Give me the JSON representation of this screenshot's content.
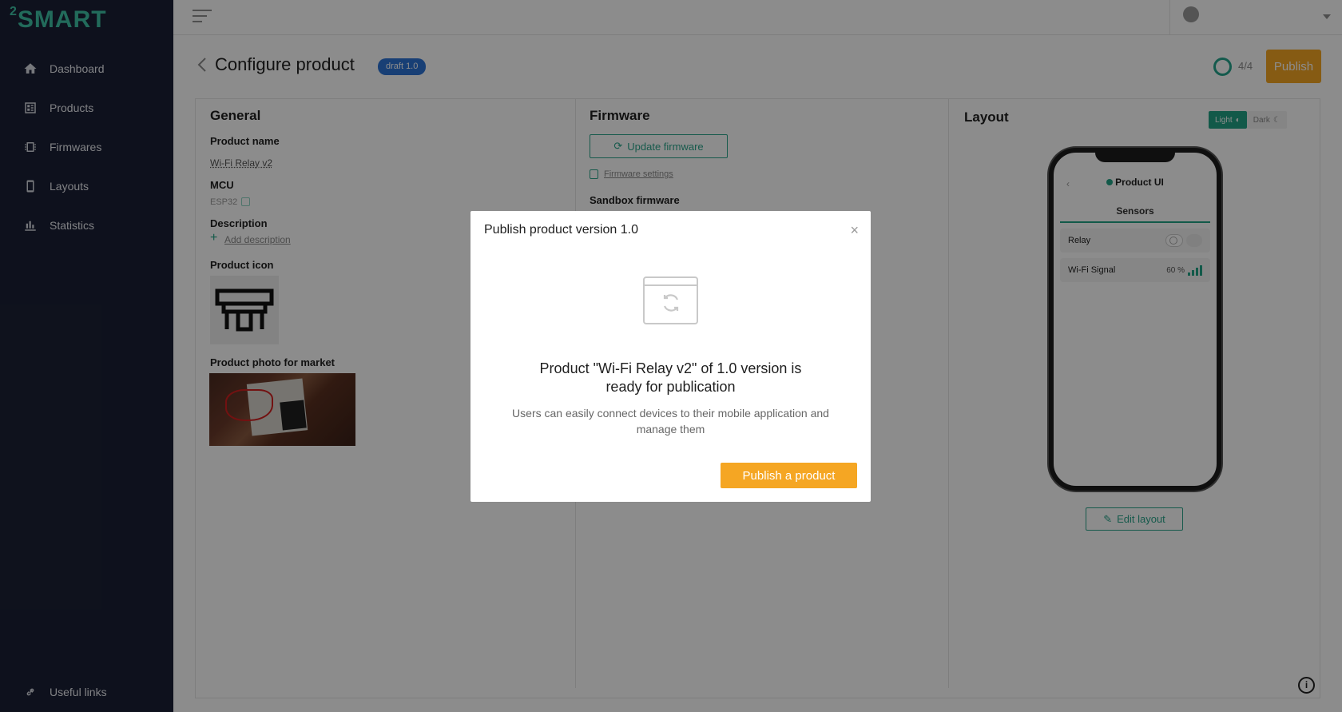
{
  "app": {
    "logo": "SMART",
    "logo_sup": "2"
  },
  "sidebar": {
    "items": [
      {
        "label": "Dashboard",
        "icon": "home-icon"
      },
      {
        "label": "Products",
        "icon": "products-icon"
      },
      {
        "label": "Firmwares",
        "icon": "firmware-icon"
      },
      {
        "label": "Layouts",
        "icon": "phone-icon"
      },
      {
        "label": "Statistics",
        "icon": "chart-icon"
      }
    ],
    "footer": {
      "label": "Useful links",
      "icon": "link-icon"
    }
  },
  "page": {
    "title": "Configure product",
    "badge": "draft 1.0",
    "progress": "4/4",
    "publish_label": "Publish"
  },
  "general": {
    "title": "General",
    "product_name_label": "Product name",
    "product_name": "Wi-Fi Relay v2",
    "mcu_label": "MCU",
    "mcu": "ESP32",
    "description_label": "Description",
    "add_description": "Add description",
    "icon_label": "Product icon",
    "photo_label": "Product photo for market"
  },
  "firmware": {
    "title": "Firmware",
    "update_label": "Update firmware",
    "settings_label": "Firmware settings",
    "sandbox_label": "Sandbox firmware"
  },
  "layout": {
    "title": "Layout",
    "light_label": "Light",
    "dark_label": "Dark",
    "phone_title": "Product UI",
    "tab": "Sensors",
    "rows": [
      {
        "label": "Relay",
        "value": ""
      },
      {
        "label": "Wi-Fi Signal",
        "value": "60 %"
      }
    ],
    "edit_label": "Edit layout"
  },
  "modal": {
    "title": "Publish product version 1.0",
    "close": "×",
    "heading_line1": "Product \"Wi-Fi Relay v2\" of 1.0 version is",
    "heading_line2": "ready for publication",
    "subtitle": "Users can easily connect devices to their mobile application and manage them",
    "button": "Publish a product"
  },
  "colors": {
    "accent": "#22a385",
    "publish": "#f5a623",
    "sidebar": "#1b2035",
    "badge": "#2c73d6"
  }
}
